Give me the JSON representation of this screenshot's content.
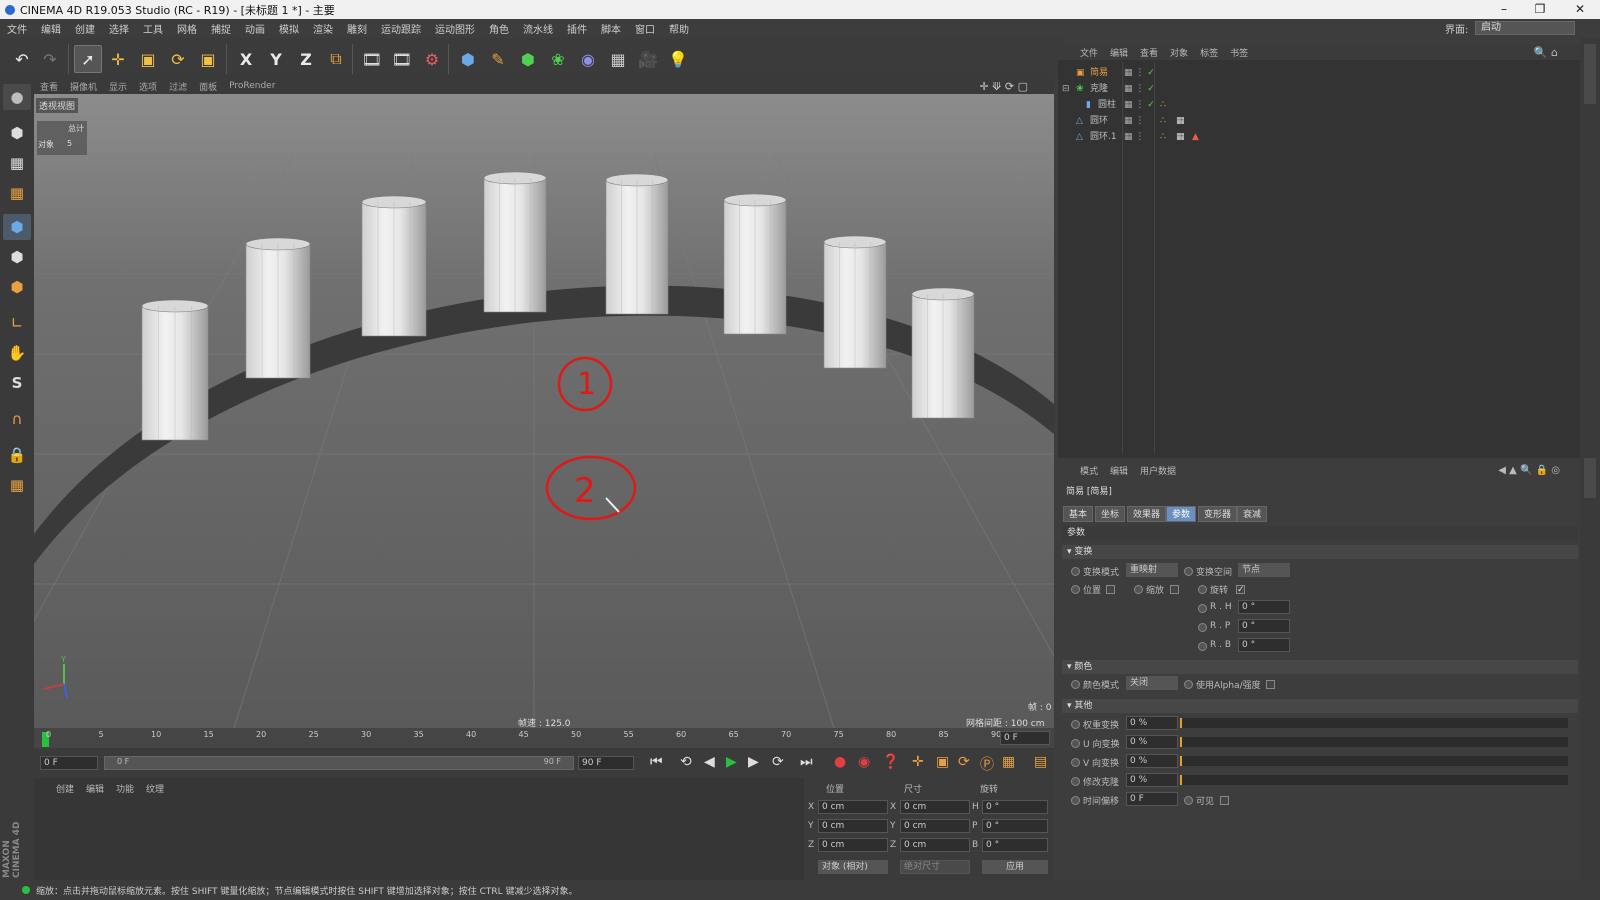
{
  "window": {
    "title": "CINEMA 4D R19.053 Studio (RC - R19) - [未标题 1 *] - 主要"
  },
  "menu": [
    "文件",
    "编辑",
    "创建",
    "选择",
    "工具",
    "网格",
    "捕捉",
    "动画",
    "模拟",
    "渲染",
    "雕刻",
    "运动跟踪",
    "运动图形",
    "角色",
    "流水线",
    "插件",
    "脚本",
    "窗口",
    "帮助"
  ],
  "layout": {
    "label": "界面:",
    "value": "启动"
  },
  "toolbar": {
    "icons": [
      "undo-icon",
      "redo-icon",
      "select-arrow-icon",
      "move-icon",
      "scale-icon",
      "rotate-icon",
      "recent-tool-icon",
      "x-axis-icon",
      "y-axis-icon",
      "z-axis-icon",
      "coordinate-system-icon",
      "render-view-icon",
      "render-picture-viewer-icon",
      "render-settings-icon",
      "cube-primitive-icon",
      "pen-spline-icon",
      "subdivision-nurbs-icon",
      "cloner-icon",
      "deformer-icon",
      "floor-icon",
      "camera-icon",
      "light-icon"
    ],
    "x": "X",
    "y": "Y",
    "z": "Z"
  },
  "viewport": {
    "menu": [
      "查看",
      "摄像机",
      "显示",
      "选项",
      "过滤",
      "面板",
      "ProRender"
    ],
    "label": "透视视图",
    "stats_total": "总计",
    "stats_obj_label": "对象",
    "stats_obj_value": "5",
    "speed": "帧速 : 125.0",
    "grid": "网格间距 : 100 cm",
    "frame": "帧 : 0",
    "annotations": [
      "1",
      "2"
    ],
    "axis_y": "Y"
  },
  "timeline": {
    "ticks": [
      "0",
      "5",
      "10",
      "15",
      "20",
      "25",
      "30",
      "35",
      "40",
      "45",
      "50",
      "55",
      "60",
      "65",
      "70",
      "75",
      "80",
      "85",
      "90"
    ],
    "frame_field": "0 F"
  },
  "transport": {
    "start": "0 F",
    "range_start": "0 F",
    "range_end": "90 F",
    "end": "90 F"
  },
  "materials": {
    "menu": [
      "创建",
      "编辑",
      "功能",
      "纹理"
    ]
  },
  "coords": {
    "headers": [
      "位置",
      "尺寸",
      "旋转"
    ],
    "rows": [
      {
        "axis": "X",
        "pos": "0 cm",
        "size": "0 cm",
        "rot_label": "H",
        "rot": "0 °"
      },
      {
        "axis": "Y",
        "pos": "0 cm",
        "size": "0 cm",
        "rot_label": "P",
        "rot": "0 °"
      },
      {
        "axis": "Z",
        "pos": "0 cm",
        "size": "0 cm",
        "rot_label": "B",
        "rot": "0 °"
      }
    ],
    "mode": "对象 (相对)",
    "size_mode": "绝对尺寸",
    "apply": "应用"
  },
  "objmgr": {
    "menu": [
      "文件",
      "编辑",
      "查看",
      "对象",
      "标签",
      "书签"
    ],
    "objects": [
      {
        "name": "简易",
        "indent": 0,
        "selected": true
      },
      {
        "name": "克隆",
        "indent": 0,
        "selected": false
      },
      {
        "name": "圆柱",
        "indent": 1,
        "selected": false
      },
      {
        "name": "圆环",
        "indent": 0,
        "selected": false
      },
      {
        "name": "圆环.1",
        "indent": 0,
        "selected": false
      }
    ]
  },
  "attr": {
    "menu": [
      "模式",
      "编辑",
      "用户数据"
    ],
    "title": "简易 [简易]",
    "tabs": [
      "基本",
      "坐标",
      "效果器",
      "参数",
      "变形器",
      "衰减"
    ],
    "active_tab": "参数",
    "section_params": "参数",
    "transform_title": "变换",
    "transform_mode_label": "变换模式",
    "transform_mode_value": "重映射",
    "transform_space_label": "变换空间",
    "transform_space_value": "节点",
    "position_label": "位置",
    "scale_label": "缩放",
    "rotate_label": "旋转",
    "rh": "R . H",
    "rh_val": "0 °",
    "rp": "R . P",
    "rp_val": "0 °",
    "rb": "R . B",
    "rb_val": "0 °",
    "color_title": "颜色",
    "color_mode_label": "颜色模式",
    "color_mode_value": "关闭",
    "use_alpha_label": "使用Alpha/强度",
    "other_title": "其他",
    "weight_label": "权重变换",
    "weight_val": "0 %",
    "u_label": "U 向变换",
    "u_val": "0 %",
    "v_label": "V 向变换",
    "v_val": "0 %",
    "clone_label": "修改克隆",
    "clone_val": "0 %",
    "time_label": "时间偏移",
    "time_val": "0 F",
    "visible_label": "可见"
  },
  "status": {
    "text": "缩放：点击并拖动鼠标缩放元素。按住 SHIFT 键量化缩放；节点编辑模式时按住 SHIFT 键增加选择对象；按住 CTRL 键减少选择对象。"
  },
  "brand": "MAXON CINEMA 4D",
  "colors": {
    "accent": "#6a8fc2",
    "annotation": "#e01818",
    "keyframe_marker": "#28c040"
  }
}
